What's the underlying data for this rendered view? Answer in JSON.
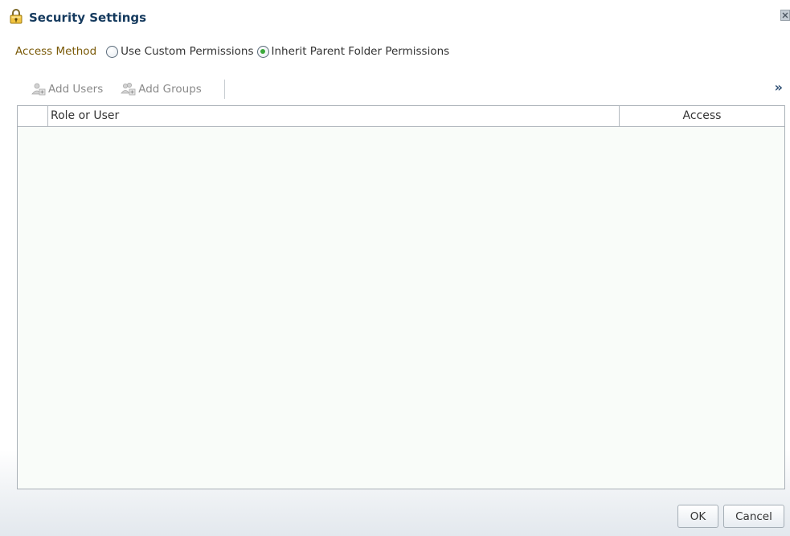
{
  "dialog": {
    "title": "Security Settings",
    "title_icon": "lock-icon"
  },
  "access_method": {
    "label": "Access Method",
    "options": [
      {
        "label": "Use Custom Permissions",
        "selected": false
      },
      {
        "label": "Inherit Parent Folder Permissions",
        "selected": true
      }
    ]
  },
  "toolbar": {
    "add_users_label": "Add Users",
    "add_users_icon": "add-users-icon",
    "add_groups_label": "Add Groups",
    "add_groups_icon": "add-groups-icon",
    "overflow_label": "»"
  },
  "table": {
    "columns": [
      "Role or User",
      "Access"
    ],
    "rows": []
  },
  "buttons": {
    "ok_label": "OK",
    "cancel_label": "Cancel"
  },
  "colors": {
    "title": "#153a5e",
    "access_label": "#7a5a08",
    "radio_selected": "#3aa83a",
    "toolbar_disabled_text": "#8a8a8a"
  }
}
